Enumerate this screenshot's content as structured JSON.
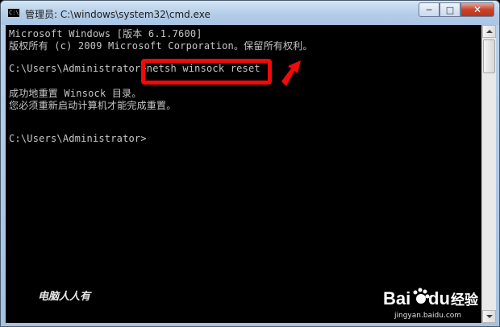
{
  "window": {
    "title": "管理员: C:\\windows\\system32\\cmd.exe",
    "icon_text": "C:\\.",
    "minimize_glyph": "─",
    "maximize_glyph": "□",
    "close_glyph": "✕"
  },
  "console": {
    "lines": [
      "Microsoft Windows [版本 6.1.7600]",
      "版权所有 (c) 2009 Microsoft Corporation。保留所有权利。",
      "",
      "C:\\Users\\Administrator>netsh winsock reset",
      "",
      "成功地重置 Winsock 目录。",
      "您必须重新启动计算机才能完成重置。",
      "",
      "",
      "C:\\Users\\Administrator>"
    ]
  },
  "annotation": {
    "highlight_color": "#f20a0a"
  },
  "watermarks": {
    "left_text": "电脑人人有",
    "logo_text_bai": "Bai",
    "logo_text_du": "du",
    "logo_text_jingyan": "经验",
    "url": "jingyan.baidu.com"
  },
  "icons": {
    "window_icon": "cmd-icon",
    "arrow": "red-arrow-icon"
  }
}
